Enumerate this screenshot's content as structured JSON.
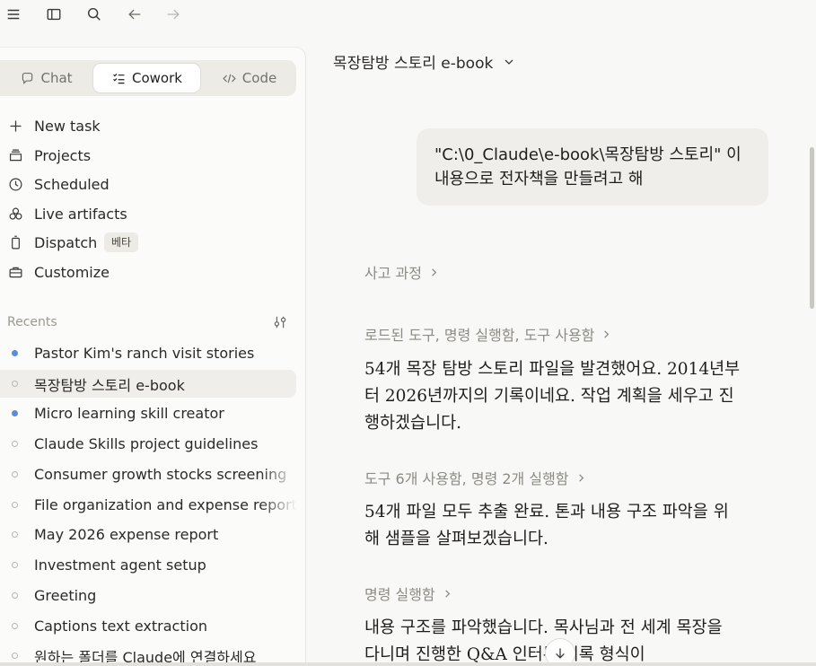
{
  "topbar": {
    "icons": [
      "menu-icon",
      "sidebar-toggle-icon",
      "search-icon",
      "back-arrow-icon",
      "forward-arrow-icon"
    ]
  },
  "modes": [
    {
      "label": "Chat",
      "icon": "chat-icon",
      "active": false
    },
    {
      "label": "Cowork",
      "icon": "cowork-icon",
      "active": true
    },
    {
      "label": "Code",
      "icon": "code-icon",
      "active": false
    }
  ],
  "nav": [
    {
      "label": "New task",
      "icon": "plus-icon"
    },
    {
      "label": "Projects",
      "icon": "folder-icon"
    },
    {
      "label": "Scheduled",
      "icon": "clock-icon"
    },
    {
      "label": "Live artifacts",
      "icon": "artifacts-icon"
    },
    {
      "label": "Dispatch",
      "icon": "dispatch-icon",
      "badge": "베타"
    },
    {
      "label": "Customize",
      "icon": "briefcase-icon"
    }
  ],
  "recents": {
    "heading": "Recents",
    "items": [
      {
        "label": "Pastor Kim's ranch visit stories",
        "dot": "filled"
      },
      {
        "label": "목장탐방 스토리 e-book",
        "dot": "hollow",
        "active": true
      },
      {
        "label": "Micro learning skill creator",
        "dot": "filled"
      },
      {
        "label": "Claude Skills project guidelines",
        "dot": "hollow"
      },
      {
        "label": "Consumer growth stocks screening",
        "dot": "hollow"
      },
      {
        "label": "File organization and expense report",
        "dot": "hollow"
      },
      {
        "label": "May 2026 expense report",
        "dot": "hollow"
      },
      {
        "label": "Investment agent setup",
        "dot": "hollow"
      },
      {
        "label": "Greeting",
        "dot": "hollow"
      },
      {
        "label": "Captions text extraction",
        "dot": "hollow"
      },
      {
        "label": "원하는 폴더를 Claude에 연결하세요",
        "dot": "hollow"
      }
    ]
  },
  "main": {
    "project_title": "목장탐방 스토리 e-book",
    "user_message": "\"C:\\0_Claude\\e-book\\목장탐방 스토리\" 이 내용으로 전자책을 만들려고 해",
    "steps": [
      {
        "label": "사고 과정"
      },
      {
        "label": "로드된 도구, 명령 실행함, 도구 사용함",
        "text": "54개 목장 탐방 스토리 파일을 발견했어요. 2014년부터 2026년까지의 기록이네요. 작업 계획을 세우고 진행하겠습니다."
      },
      {
        "label": "도구 6개 사용함, 명령 2개 실행함",
        "text": "54개 파일 모두 추출 완료. 톤과 내용 구조 파악을 위해 샘플을 살펴보겠습니다."
      },
      {
        "label": "명령 실행함",
        "text": "내용 구조를 파악했습니다. 목사님과 전 세계 목장을 다니며 진행한 Q&A 인터뷰 기록 형식이"
      }
    ]
  }
}
